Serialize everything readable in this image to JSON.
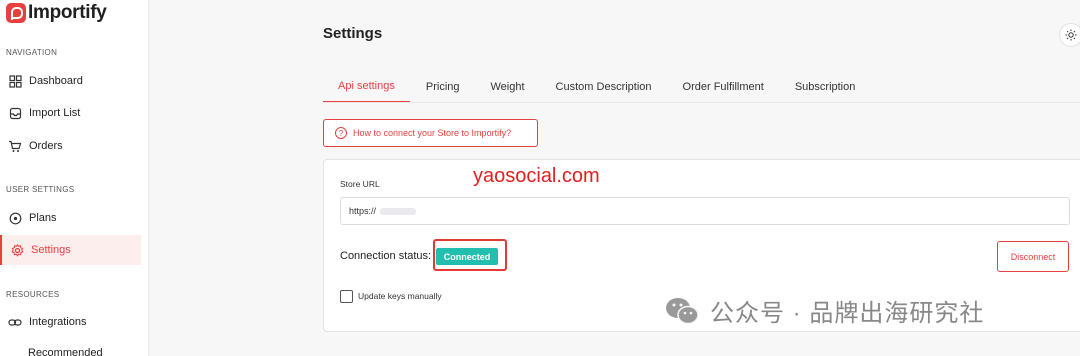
{
  "app": {
    "name": "Importify"
  },
  "sidebar": {
    "sections": {
      "navigation": "NAVIGATION",
      "user_settings": "USER SETTINGS",
      "resources": "RESOURCES"
    },
    "items": [
      {
        "label": "Dashboard",
        "icon": "grid-icon"
      },
      {
        "label": "Import List",
        "icon": "inbox-icon"
      },
      {
        "label": "Orders",
        "icon": "cart-icon"
      },
      {
        "label": "Plans",
        "icon": "plans-icon"
      },
      {
        "label": "Settings",
        "icon": "gear-icon",
        "active": true
      },
      {
        "label": "Integrations",
        "icon": "link-icon"
      },
      {
        "label": "Recommended"
      }
    ]
  },
  "main": {
    "title": "Settings",
    "tabs": [
      {
        "label": "Api settings",
        "active": true
      },
      {
        "label": "Pricing"
      },
      {
        "label": "Weight"
      },
      {
        "label": "Custom Description"
      },
      {
        "label": "Order Fulfillment"
      },
      {
        "label": "Subscription"
      }
    ],
    "help_button": "How to connect your Store to Importify?",
    "store_url_label": "Store URL",
    "store_url_value": "https://",
    "connection_status_label": "Connection status:",
    "connection_status_badge": "Connected",
    "disconnect_button": "Disconnect",
    "update_keys_label": "Update keys manually",
    "update_keys_checked": false
  },
  "overlays": {
    "watermark_text": "yaosocial.com",
    "wechat_text": "公众号 · 品牌出海研究社"
  },
  "colors": {
    "accent": "#e8403f",
    "connected": "#22bfae",
    "highlight_box": "#e53935"
  }
}
